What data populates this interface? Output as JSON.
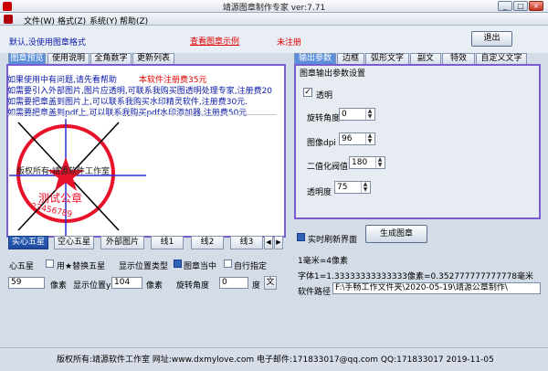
{
  "window": {
    "title": "靖源图章制作专家 ver:7.71",
    "min": "_",
    "max": "□",
    "close": "×"
  },
  "menu": {
    "items": [
      {
        "label": "文件(W)"
      },
      {
        "label": "格式(Z)"
      },
      {
        "label": "系统(Y)"
      },
      {
        "label": "帮助(Z)"
      }
    ]
  },
  "top": {
    "default_msg": "默认,没使用图章格式",
    "sample_link": "查看图章示例",
    "unregistered": "未注册",
    "exit": "退出"
  },
  "left_tabs": [
    "图章预览",
    "使用说明",
    "全角数字",
    "更新列表"
  ],
  "left_info": {
    "line1": "如果使用中有问题,请先看帮助",
    "price": "本软件注册费35元",
    "line2": "如需要引入外部图片,图片应透明,可联系我购买图透明处理专家,注册费20",
    "line3": "如需要把章盖到图片上,可以联系我购买水印精灵软件,注册费30元.",
    "line4": "如需要把章盖到pdf上,可以联系我购买pdf水印添加器,注册费50元."
  },
  "stamp": {
    "color": "#e8132a",
    "top_text": "版权所有:靖源软件工作室",
    "company": "测试公章",
    "number": "23456789"
  },
  "right_tabs": [
    "输出参数",
    "边框",
    "弧形文字",
    "副文",
    "特效",
    "自定义文字"
  ],
  "right_panel": {
    "title": "图章输出参数设置",
    "transparent_label": "透明",
    "transparent_checked": "✓",
    "rotation_label": "旋转角度",
    "rotation_value": "0",
    "dpi_label": "图像dpi",
    "dpi_value": "96",
    "binarize_label": "二值化阀值",
    "binarize_value": "180",
    "opacity_label": "透明度",
    "opacity_value": "75"
  },
  "shape_buttons": [
    "实心五星",
    "空心五星",
    "外部图片",
    "线1",
    "线2",
    "线3"
  ],
  "star_options": {
    "center_star_label": "心五星",
    "replace_label": "用★替换五星",
    "pos_type_label": "显示位置类型",
    "chapter_center_label": "图章当中",
    "custom_label": "自行指定",
    "size_value": "59",
    "size_unit": "像素",
    "pos_y_label": "显示位置y",
    "pos_y_value": "104",
    "pos_y_unit": "像素",
    "rot_label": "旋转角度",
    "rot_value": "0",
    "rot_unit": "度",
    "extra_btn": "文"
  },
  "right_bottom": {
    "refresh_label": "实时刷新界面",
    "generate": "生成图章",
    "mm_pixels": "1毫米=4像素",
    "font_info": "字体1=1.33333333333333像素=0.352777777777778毫米",
    "path_label": "软件路径",
    "path_value": "F:\\手畅工作文件夹\\2020-05-19\\靖源公章制作\\"
  },
  "status": {
    "text": "版权所有:靖源软件工作室   网址:www.dxmylove.com  电子邮件:171833017@qq.com  QQ:171833017    2019-11-05"
  }
}
